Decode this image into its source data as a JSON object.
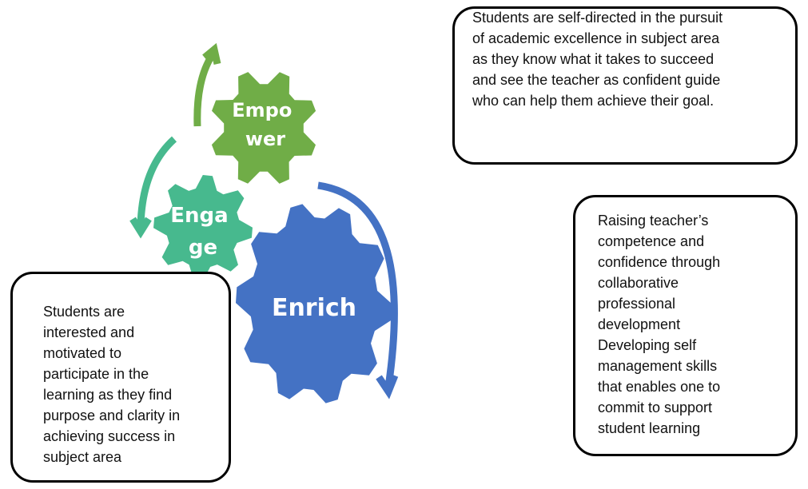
{
  "gears": [
    {
      "id": "empower",
      "label_lines": [
        "Empo",
        "wer"
      ],
      "color": "#70ad47"
    },
    {
      "id": "engage",
      "label_lines": [
        "Enga",
        "ge"
      ],
      "color": "#47b98e"
    },
    {
      "id": "enrich",
      "label_lines": [
        "Enrich"
      ],
      "color": "#4472c4"
    }
  ],
  "arrows": [
    {
      "id": "empower-arrow",
      "color": "#70ad47"
    },
    {
      "id": "engage-arrow",
      "color": "#47b98e"
    },
    {
      "id": "enrich-arrow",
      "color": "#4472c4"
    }
  ],
  "boxes": {
    "top": "Students are self-directed in the pursuit\nof academic excellence in subject area\nas they know what it takes to succeed\nand see the teacher as confident guide\nwho can help them achieve their goal.",
    "left": "Students are\ninterested and\nmotivated to\nparticipate in the\nlearning as they find\npurpose and clarity in\nachieving success in\nsubject area",
    "right": "Raising teacher’s\ncompetence and\nconfidence through\ncollaborative\nprofessional\ndevelopment\nDeveloping self\nmanagement skills\nthat enables one to\ncommit to support\nstudent learning"
  }
}
